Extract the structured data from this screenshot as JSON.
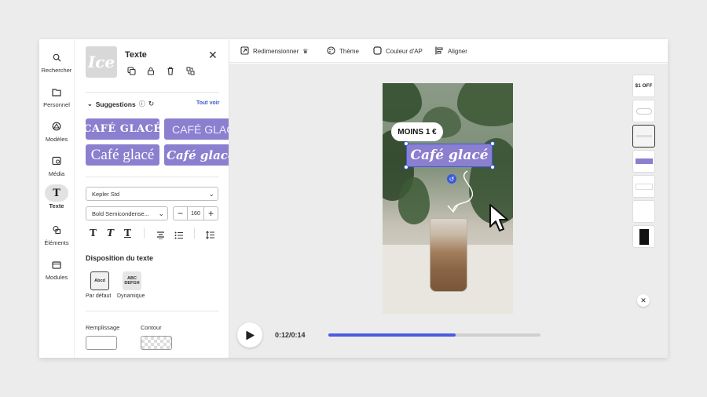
{
  "rail": {
    "items": [
      {
        "label": "Rechercher",
        "icon": "search-icon"
      },
      {
        "label": "Personnel",
        "icon": "folder-icon"
      },
      {
        "label": "Modèles",
        "icon": "templates-icon"
      },
      {
        "label": "Média",
        "icon": "media-icon"
      },
      {
        "label": "Texte",
        "icon": "text-icon"
      },
      {
        "label": "Éléments",
        "icon": "elements-icon"
      },
      {
        "label": "Modules",
        "icon": "modules-icon"
      }
    ]
  },
  "panel": {
    "thumb_text": "Ice",
    "title": "Texte",
    "suggestions_label": "Suggestions",
    "see_all": "Tout voir",
    "chips": [
      "CAFÉ GLACÉ",
      "CAFÉ GLACÉ",
      "Café glacé",
      "Café glacé"
    ],
    "font_family": "Kepler Std",
    "font_style": "Bold Semicondense...",
    "font_size": "160",
    "layout_title": "Disposition du texte",
    "layout_default_label": "Par défaut",
    "layout_dynamic_label": "Dynamique",
    "layout_default_icon_text": "Abcd",
    "layout_dynamic_icon_text": "ABC DEFGH",
    "fill_label": "Remplissage",
    "stroke_label": "Contour"
  },
  "toolbar": {
    "resize": "Redimensionner",
    "theme": "Thème",
    "color": "Couleur d'AP",
    "align": "Aligner"
  },
  "canvas": {
    "badge": "MOINS 1 €",
    "title_text": "Café glacé"
  },
  "playback": {
    "time": "0:12/0:14",
    "progress": 0.6
  },
  "scenes": {
    "first_label": "$1 OFF"
  },
  "colors": {
    "accent_purple": "#8b7fcf",
    "selection_blue": "#3b5bdb",
    "progress_blue": "#4a5be0"
  }
}
